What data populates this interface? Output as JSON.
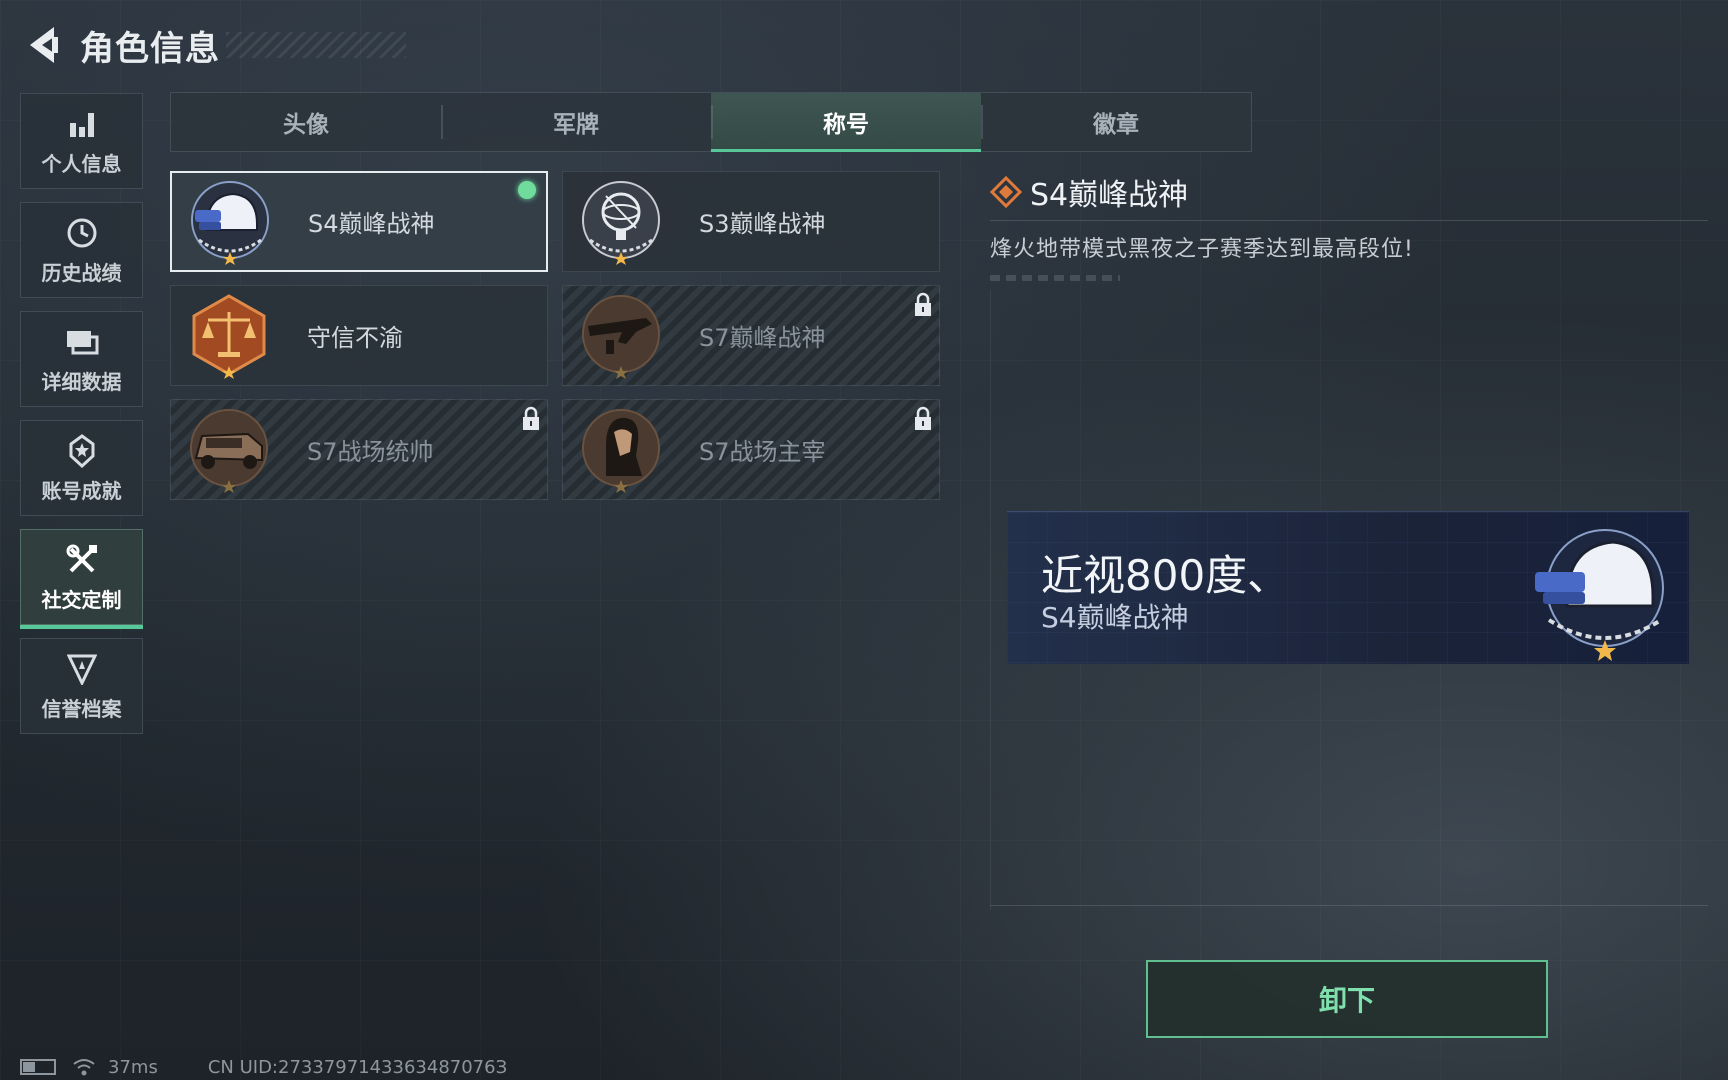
{
  "header": {
    "title": "角色信息"
  },
  "sidebar": {
    "items": [
      {
        "label": "个人信息",
        "icon": "bar-chart-icon",
        "active": false
      },
      {
        "label": "历史战绩",
        "icon": "clock-icon",
        "active": false
      },
      {
        "label": "详细数据",
        "icon": "folder-icon",
        "active": false
      },
      {
        "label": "账号成就",
        "icon": "medal-icon",
        "active": false
      },
      {
        "label": "社交定制",
        "icon": "tools-icon",
        "active": true
      },
      {
        "label": "信誉档案",
        "icon": "shield-icon",
        "active": false
      }
    ]
  },
  "tabs": [
    {
      "label": "头像",
      "active": false
    },
    {
      "label": "军牌",
      "active": false
    },
    {
      "label": "称号",
      "active": true
    },
    {
      "label": "徽章",
      "active": false
    }
  ],
  "titles": [
    {
      "label": "S4巅峰战神",
      "icon": "helmet-badge-icon",
      "selected": true,
      "equipped": true,
      "locked": false
    },
    {
      "label": "S3巅峰战神",
      "icon": "astrolabe-badge-icon",
      "selected": false,
      "equipped": false,
      "locked": false
    },
    {
      "label": "守信不渝",
      "icon": "scales-badge-icon",
      "selected": false,
      "equipped": false,
      "locked": false
    },
    {
      "label": "S7巅峰战神",
      "icon": "rifle-badge-icon",
      "selected": false,
      "equipped": false,
      "locked": true
    },
    {
      "label": "S7战场统帅",
      "icon": "vehicle-badge-icon",
      "selected": false,
      "equipped": false,
      "locked": true
    },
    {
      "label": "S7战场主宰",
      "icon": "soldier-badge-icon",
      "selected": false,
      "equipped": false,
      "locked": true
    }
  ],
  "detail": {
    "name": "S4巅峰战神",
    "description": "烽火地带模式黑夜之子赛季达到最高段位!"
  },
  "preview": {
    "player_name": "近视800度、",
    "title": "S4巅峰战神"
  },
  "actions": {
    "unequip_label": "卸下"
  },
  "status": {
    "ping": "37ms",
    "uid": "CN UID:2733797143363487076З"
  },
  "colors": {
    "accent_green": "#58c79a",
    "equipped_dot": "#6fdc9e",
    "diamond_orange": "#e07a3a"
  }
}
